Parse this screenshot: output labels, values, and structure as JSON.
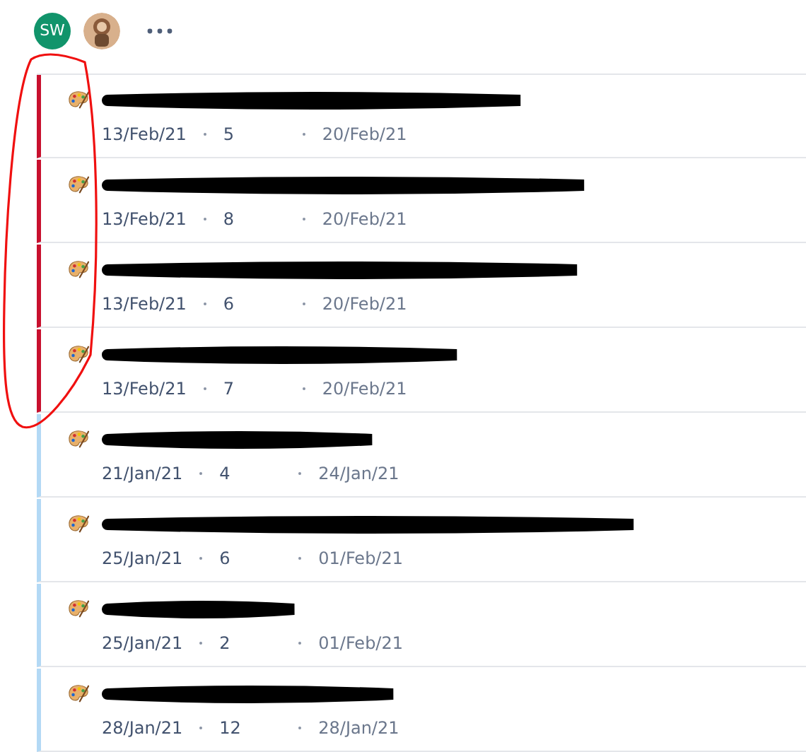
{
  "header": {
    "avatars": [
      {
        "kind": "initials",
        "initials": "SW",
        "color": "#11946b"
      },
      {
        "kind": "picture"
      }
    ]
  },
  "issues": [
    {
      "created": "13/Feb/21",
      "count": "5",
      "due": "20/Feb/21",
      "color": "#c8102e"
    },
    {
      "created": "13/Feb/21",
      "count": "8",
      "due": "20/Feb/21",
      "color": "#c8102e"
    },
    {
      "created": "13/Feb/21",
      "count": "6",
      "due": "20/Feb/21",
      "color": "#c8102e"
    },
    {
      "created": "13/Feb/21",
      "count": "7",
      "due": "20/Feb/21",
      "color": "#c8102e"
    },
    {
      "created": "21/Jan/21",
      "count": "4",
      "due": "24/Jan/21",
      "color": "#b3d9f5"
    },
    {
      "created": "25/Jan/21",
      "count": "6",
      "due": "01/Feb/21",
      "color": "#b3d9f5"
    },
    {
      "created": "25/Jan/21",
      "count": "2",
      "due": "01/Feb/21",
      "color": "#b3d9f5"
    },
    {
      "created": "28/Jan/21",
      "count": "12",
      "due": "28/Jan/21",
      "color": "#b3d9f5"
    }
  ]
}
